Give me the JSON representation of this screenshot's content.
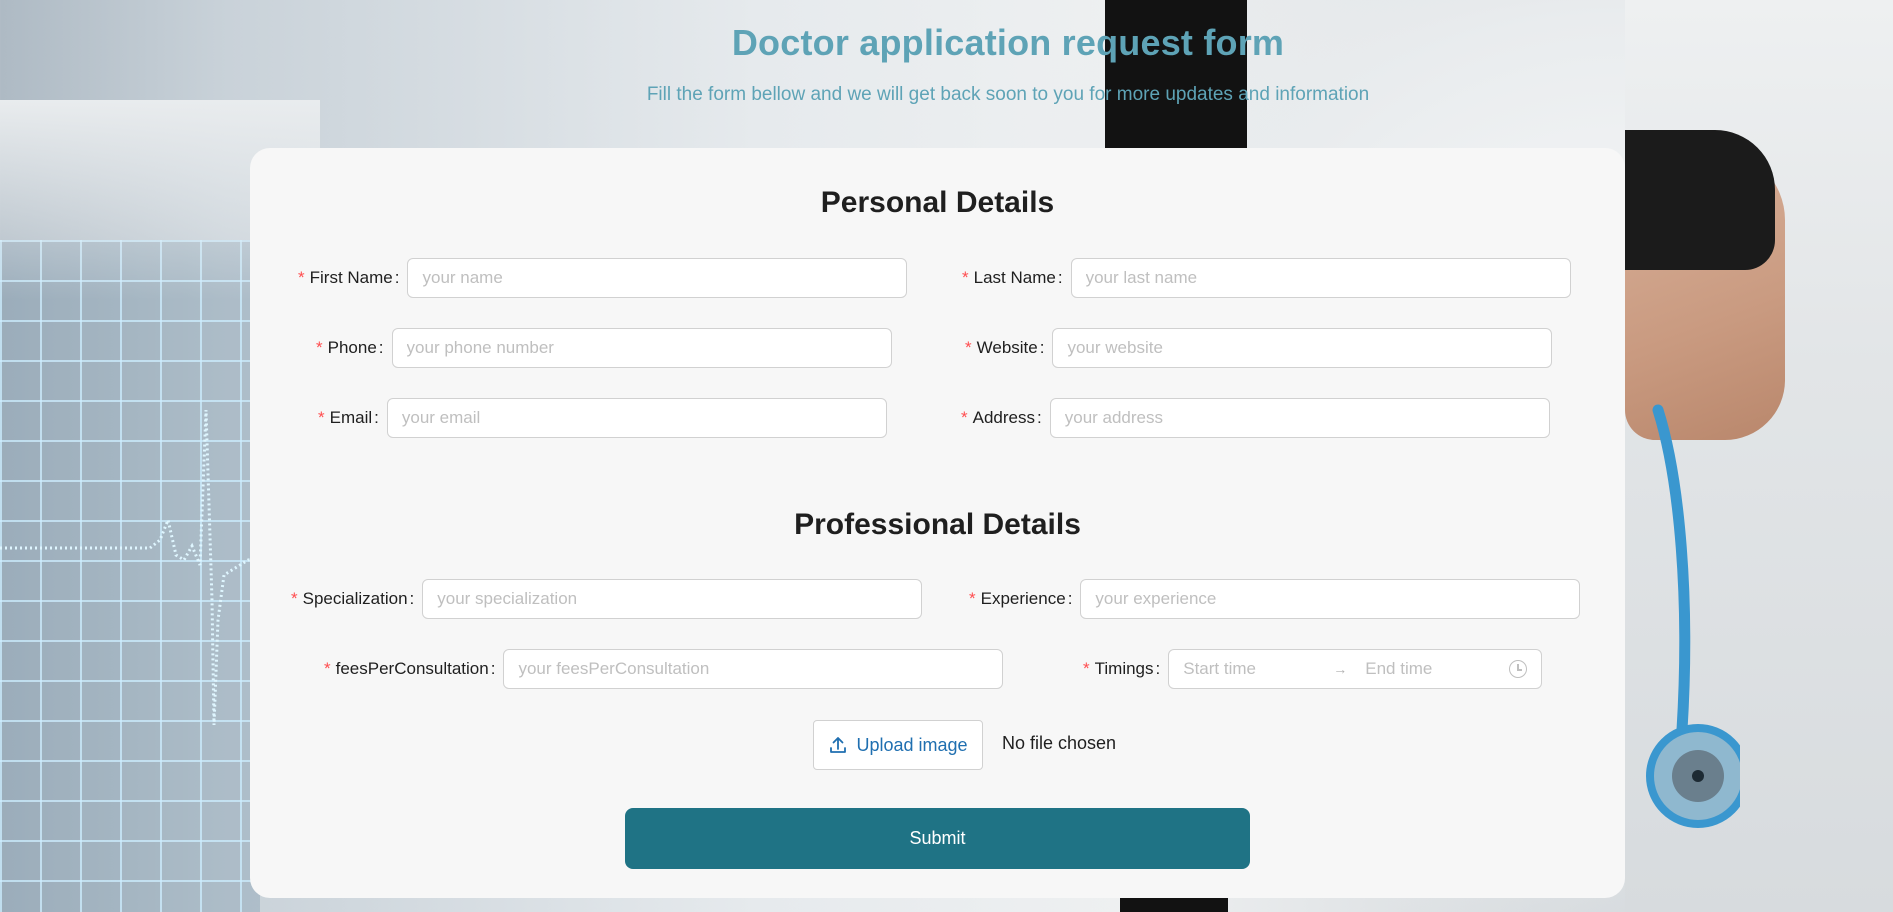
{
  "header": {
    "title": "Doctor application request form",
    "subtitle": "Fill the form bellow and we will get back soon to you for more updates and information"
  },
  "personal": {
    "heading": "Personal Details",
    "first_name": {
      "label": "First Name",
      "placeholder": "your name"
    },
    "last_name": {
      "label": "Last Name",
      "placeholder": "your last name"
    },
    "phone": {
      "label": "Phone",
      "placeholder": "your phone number"
    },
    "website": {
      "label": "Website",
      "placeholder": "your website"
    },
    "email": {
      "label": "Email",
      "placeholder": "your email"
    },
    "address": {
      "label": "Address",
      "placeholder": "your address"
    }
  },
  "professional": {
    "heading": "Professional Details",
    "specialization": {
      "label": "Specialization",
      "placeholder": "your specialization"
    },
    "experience": {
      "label": "Experience",
      "placeholder": "your experience"
    },
    "fees": {
      "label": "feesPerConsultation",
      "placeholder": "your feesPerConsultation"
    },
    "timings": {
      "label": "Timings",
      "start_placeholder": "Start time",
      "end_placeholder": "End time",
      "separator": "→"
    }
  },
  "upload": {
    "button_label": "Upload image",
    "status": "No file chosen"
  },
  "submit_label": "Submit",
  "colors": {
    "accent": "#1f7385",
    "title": "#5ea3b6",
    "required": "#ff4d4f",
    "upload_text": "#1f6fb0"
  },
  "required_mark": "*",
  "colon": ":"
}
